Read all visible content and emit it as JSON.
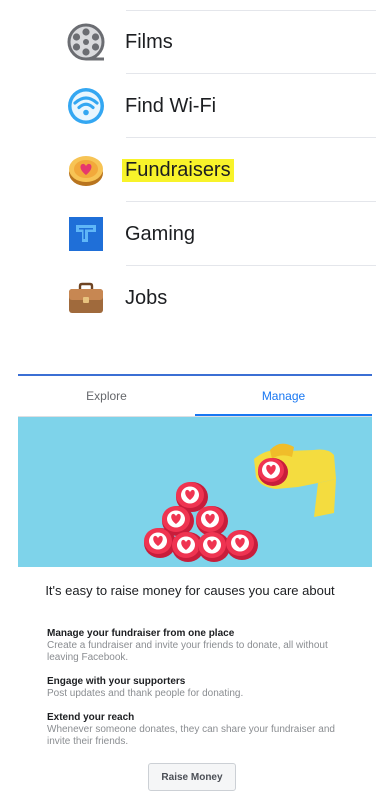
{
  "menu": {
    "items": [
      {
        "label": "Films",
        "icon": "film-reel-icon",
        "highlighted": false
      },
      {
        "label": "Find Wi-Fi",
        "icon": "wifi-icon",
        "highlighted": false
      },
      {
        "label": "Fundraisers",
        "icon": "fundraiser-coin-icon",
        "highlighted": true
      },
      {
        "label": "Gaming",
        "icon": "gaming-icon",
        "highlighted": false
      },
      {
        "label": "Jobs",
        "icon": "briefcase-icon",
        "highlighted": false
      }
    ],
    "highlight_color": "#f8f32a"
  },
  "fundraiser": {
    "tabs": [
      {
        "label": "Explore",
        "active": false
      },
      {
        "label": "Manage",
        "active": true
      }
    ],
    "accent_color": "#1877f2",
    "hero_background": "#7ed3ea",
    "headline": "It's easy to raise money for causes you care about",
    "features": [
      {
        "title": "Manage your fundraiser from one place",
        "description": "Create a fundraiser and invite your friends to donate, all without leaving Facebook."
      },
      {
        "title": "Engage with your supporters",
        "description": "Post updates and thank people for donating."
      },
      {
        "title": "Extend your reach",
        "description": "Whenever someone donates, they can share your fundraiser and invite their friends."
      }
    ],
    "button_label": "Raise Money"
  }
}
